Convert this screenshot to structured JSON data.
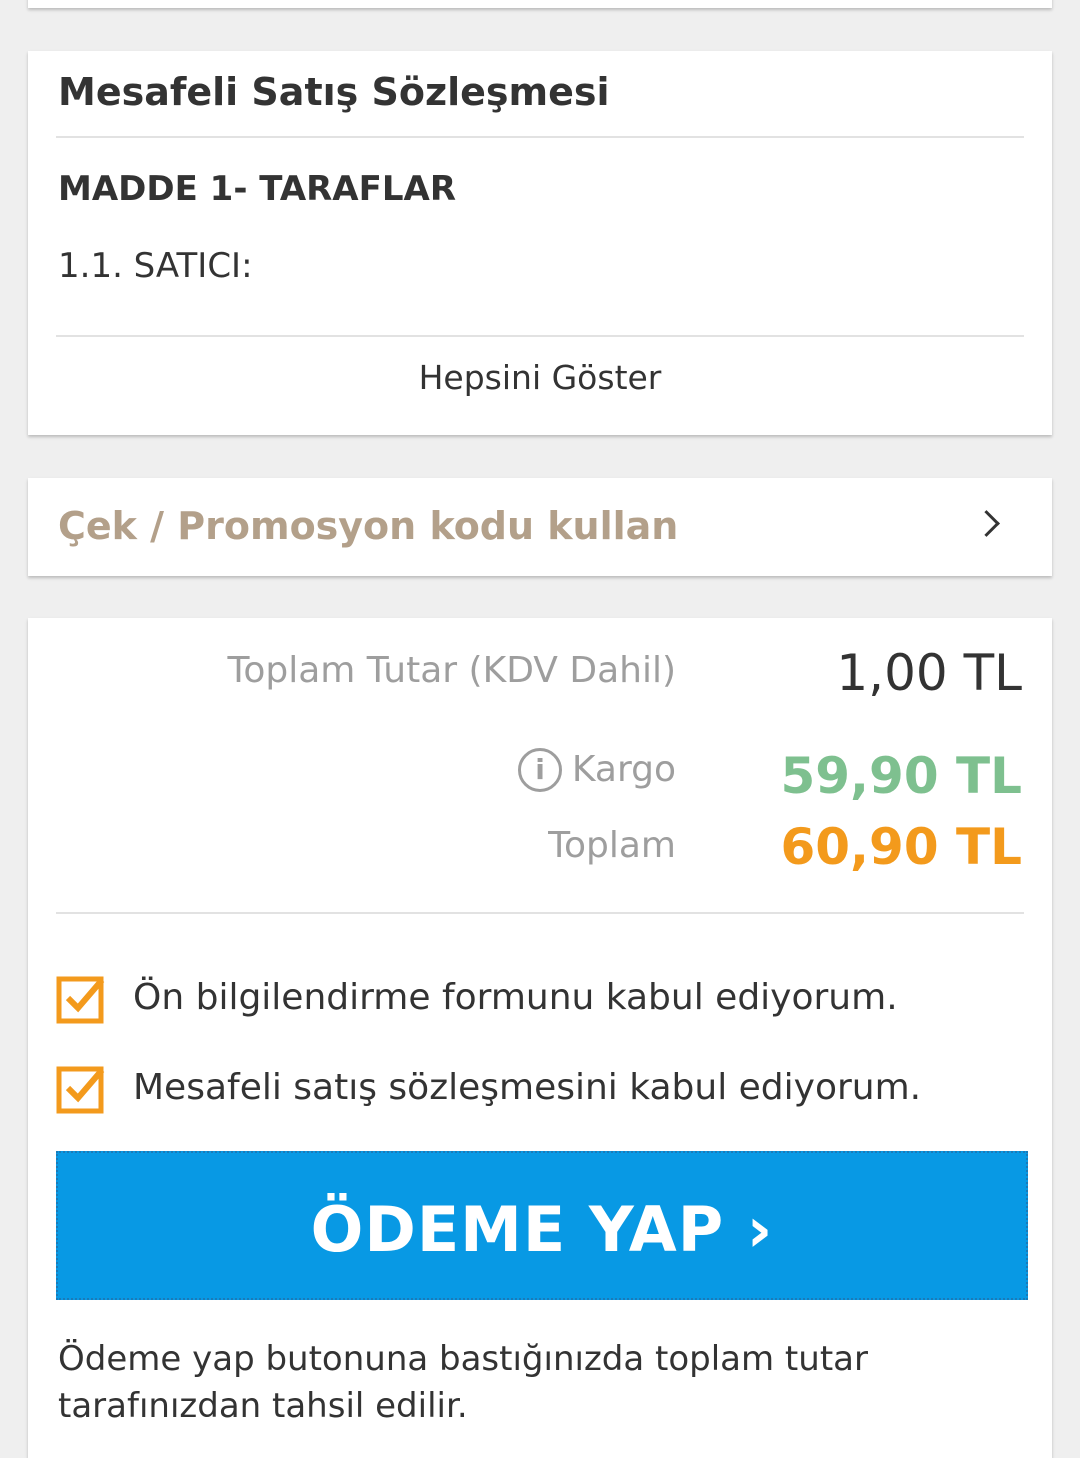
{
  "contract": {
    "title": "Mesafeli Satış Sözleşmesi",
    "article_heading": "MADDE 1- TARAFLAR",
    "article_text": "1.1. SATICI:",
    "show_all_label": "Hepsini Göster"
  },
  "promo": {
    "label": "Çek / Promosyon kodu kullan",
    "chevron_icon": "chevron-right-icon"
  },
  "summary": {
    "subtotal_label": "Toplam Tutar (KDV Dahil)",
    "subtotal_value": "1,00 TL",
    "shipping_label": "Kargo",
    "shipping_value": "59,90 TL",
    "total_label": "Toplam",
    "total_value": "60,90 TL",
    "info_icon": "info-icon",
    "colors": {
      "shipping": "#7ec08f",
      "total": "#f39a1c",
      "checkbox": "#f39a1c",
      "button": "#0899e4",
      "promo_text": "#b3a08a"
    }
  },
  "agreements": [
    {
      "label": "Ön bilgilendirme formunu kabul ediyorum.",
      "checked": true
    },
    {
      "label": "Mesafeli satış sözleşmesini kabul ediyorum.",
      "checked": true
    }
  ],
  "pay_button": {
    "label": "ÖDEME YAP ›"
  },
  "pay_note": "Ödeme yap butonuna bastığınızda toplam tutar tarafınızdan tahsil edilir."
}
